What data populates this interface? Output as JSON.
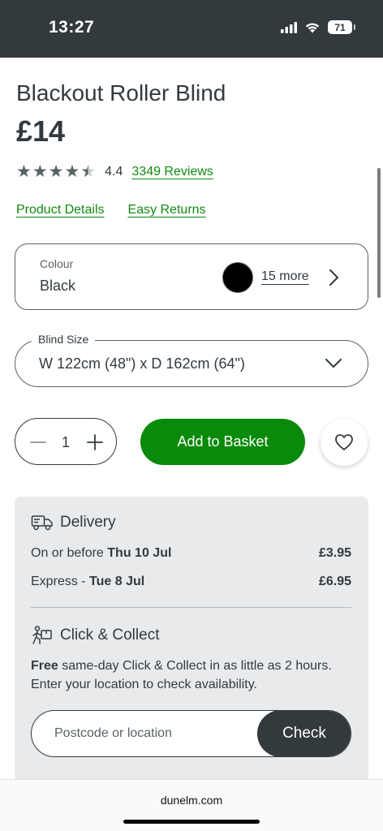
{
  "status_bar": {
    "time": "13:27",
    "battery": "71"
  },
  "product": {
    "title": "Blackout Roller Blind",
    "price": "£14",
    "rating": 4.4,
    "rating_text": "4.4",
    "reviews_link": "3349 Reviews",
    "star_icons": [
      "star-full-icon",
      "star-full-icon",
      "star-full-icon",
      "star-full-icon",
      "star-half-icon"
    ]
  },
  "links": {
    "product_details": "Product Details",
    "easy_returns": "Easy Returns"
  },
  "colour": {
    "label": "Colour",
    "value": "Black",
    "swatch_color": "#000000",
    "more": "15 more"
  },
  "size": {
    "legend": "Blind Size",
    "value": "W 122cm (48\") x D 162cm (64\")"
  },
  "quantity": {
    "value": "1"
  },
  "actions": {
    "add_to_basket": "Add to Basket"
  },
  "delivery": {
    "heading": "Delivery",
    "options": [
      {
        "prefix": "On or before ",
        "date": "Thu 10 Jul",
        "price": "£3.95"
      },
      {
        "prefix": "Express - ",
        "date": "Tue 8 Jul",
        "price": "£6.95"
      }
    ]
  },
  "click_collect": {
    "heading": "Click & Collect",
    "free": "Free",
    "text": " same-day Click & Collect in as little as 2 hours. Enter your location to check availability.",
    "placeholder": "Postcode or location",
    "check": "Check"
  },
  "browser": {
    "url": "dunelm.com"
  },
  "colors": {
    "brand_green": "#0a8a0a",
    "dark": "#323a3e",
    "panel": "#e8eaec"
  }
}
